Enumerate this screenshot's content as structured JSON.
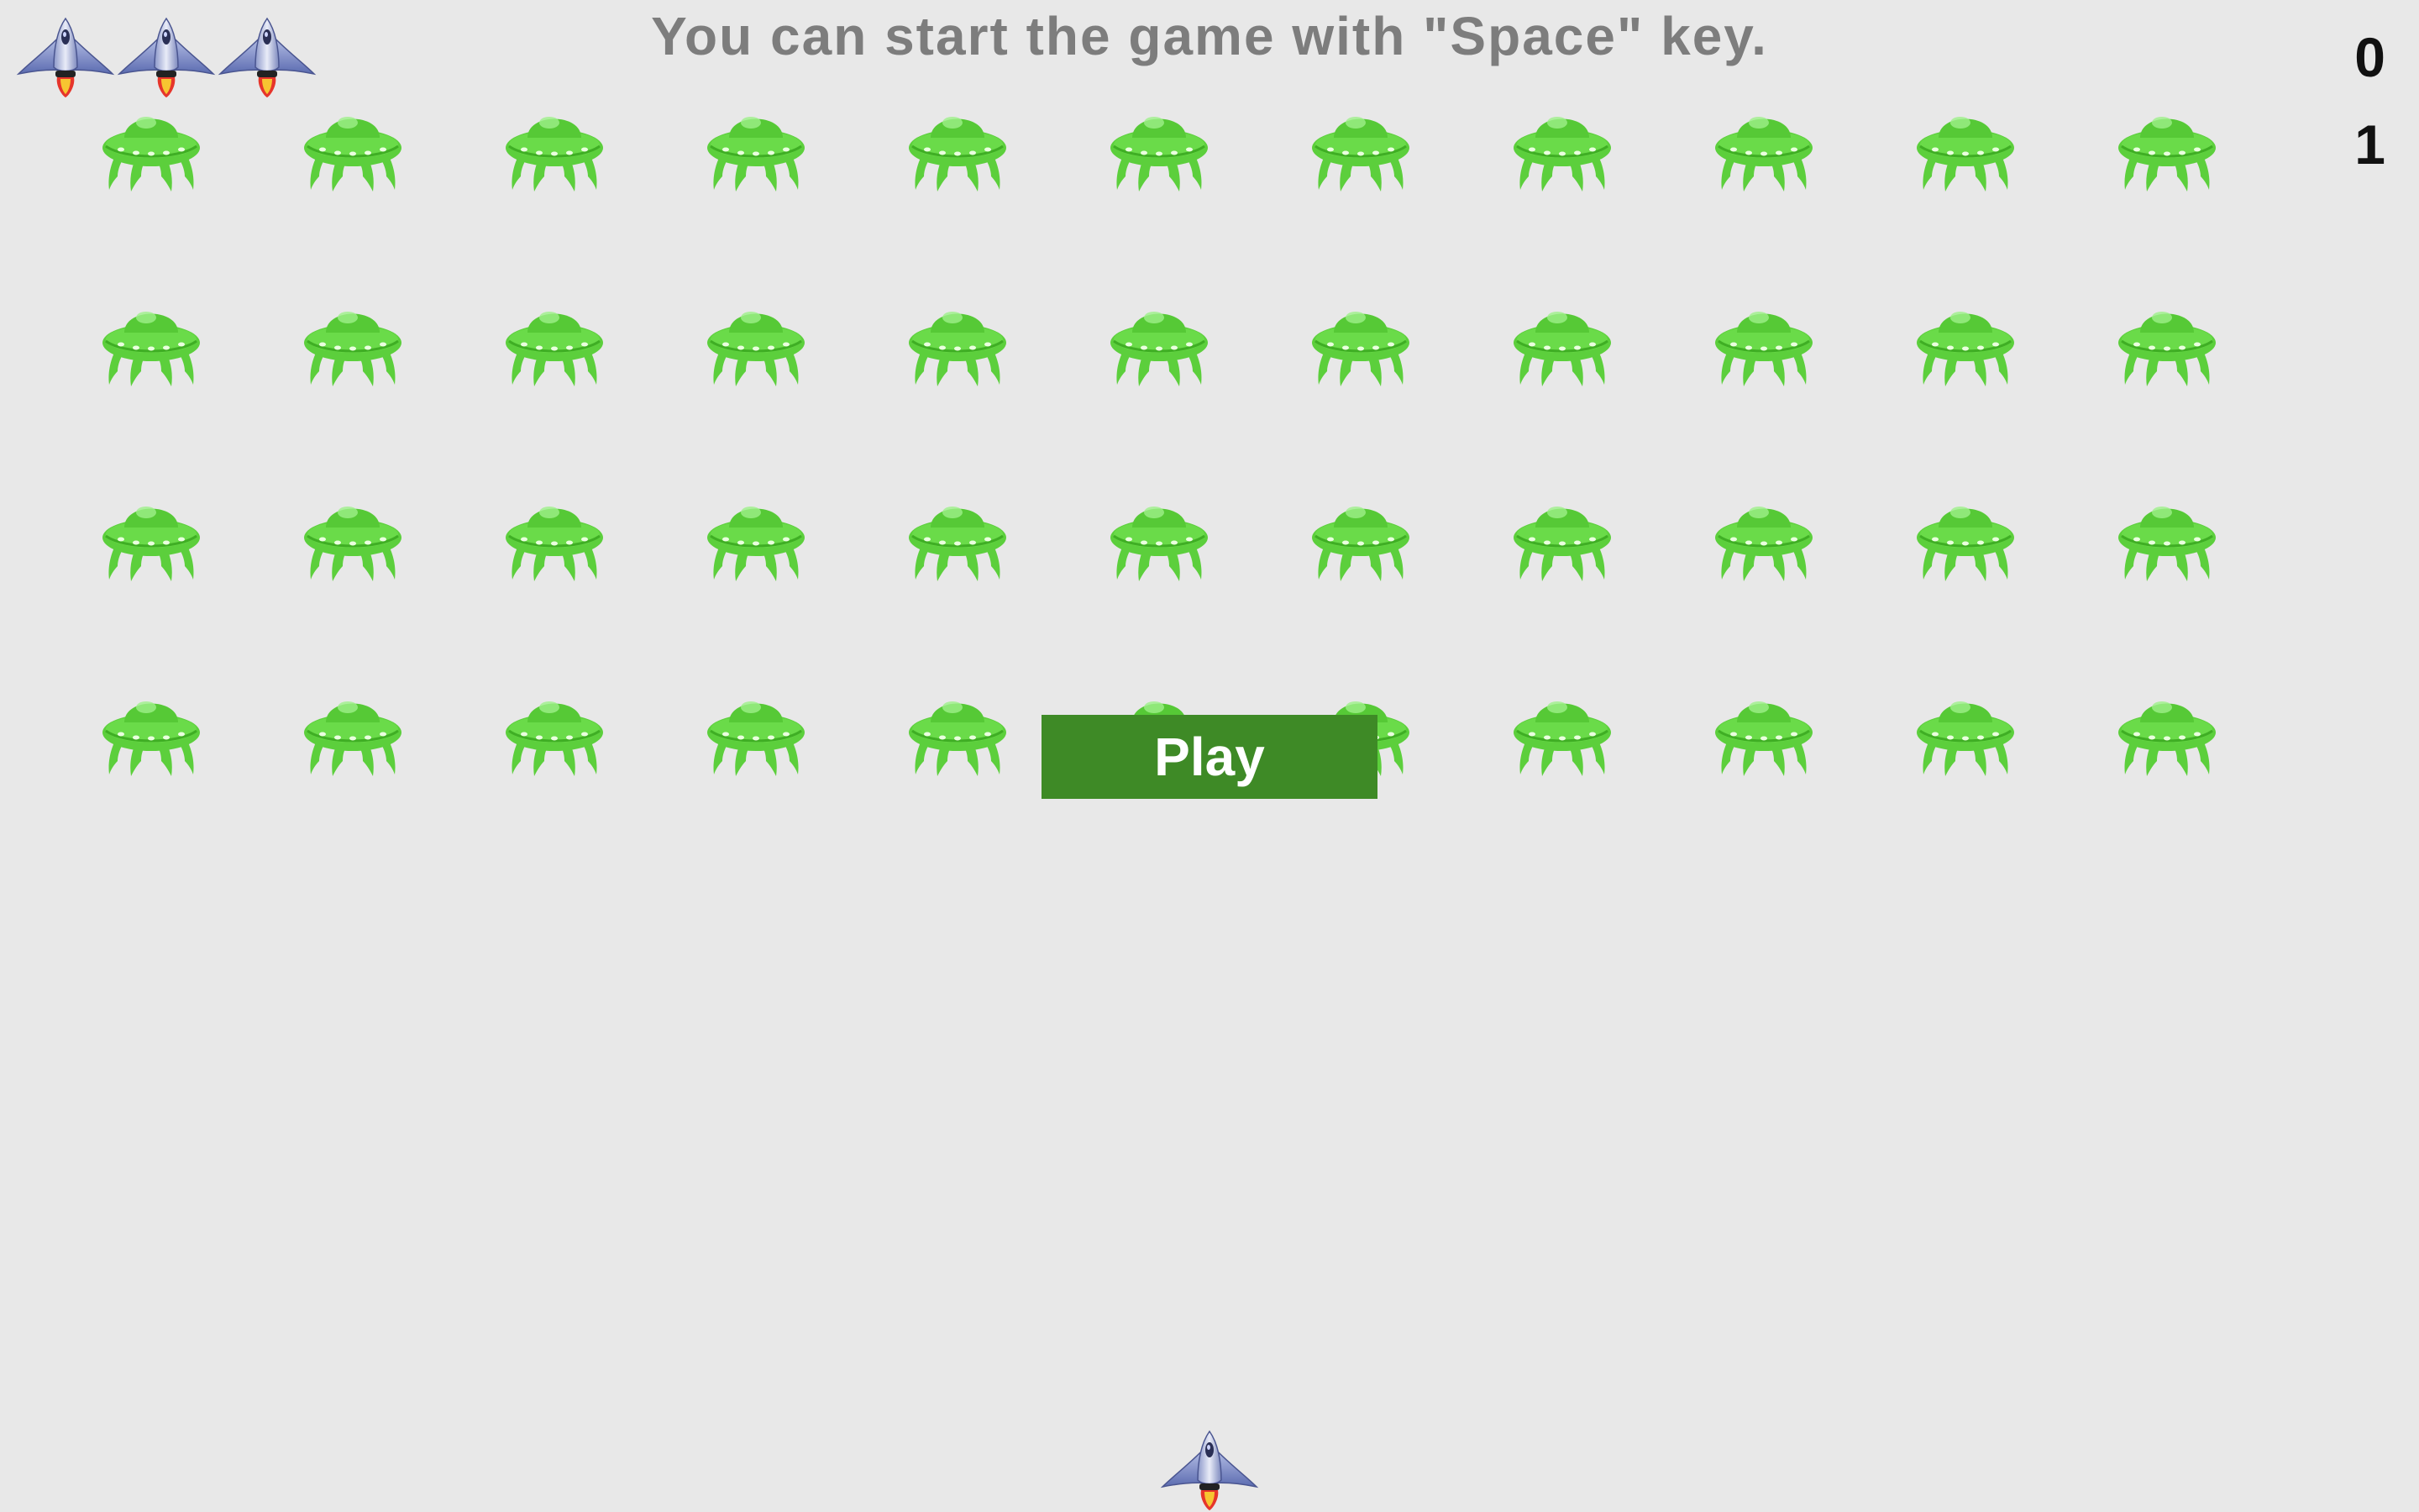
{
  "hint_text": "You can start the game with \"Space\" key.",
  "score": "0",
  "level": "1",
  "lives_remaining": 3,
  "play_label": "Play",
  "alien_grid": {
    "rows": 4,
    "cols": 11
  },
  "colors": {
    "background": "#e8e8e8",
    "alien": "#5ccf3c",
    "play_button": "#3e8a26",
    "hint_text": "#7d7d7d",
    "ship_body": "#9aa6d6"
  },
  "icons": {
    "ship": "spaceship-icon",
    "alien": "alien-ufo-icon"
  }
}
